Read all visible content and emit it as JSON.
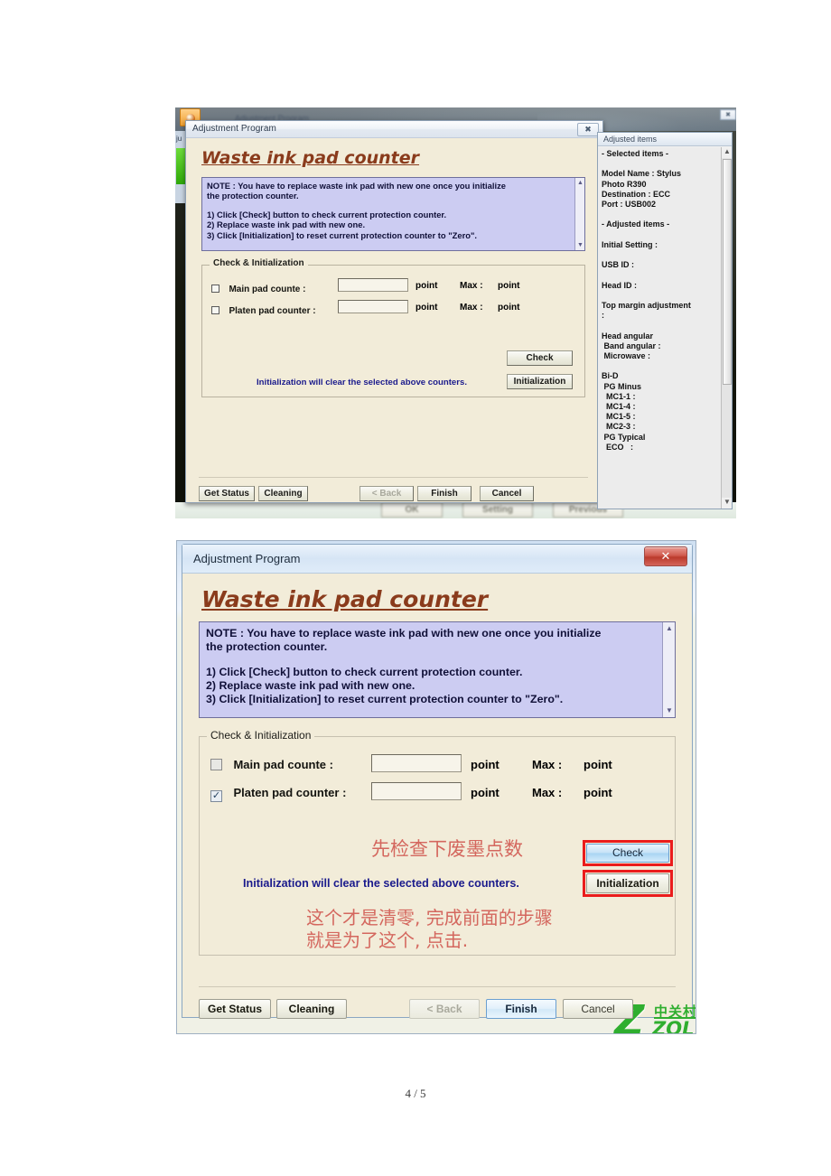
{
  "document": {
    "page_label": "4 / 5"
  },
  "screenshot_top": {
    "background_window": {
      "ghost_title": "Adjustment Program",
      "left_stub_label": "ju",
      "ghost_buttons": [
        "OK",
        "Setting",
        "Previous"
      ]
    },
    "dialog": {
      "title": "Adjustment Program",
      "close_label": "✖",
      "heading": "Waste ink pad counter",
      "note": {
        "line1": "NOTE : You have to replace waste ink pad with new one once you initialize",
        "line2": "the protection counter.",
        "line3": "",
        "line4": "1) Click [Check] button to check current protection counter.",
        "line5": "2) Replace waste ink pad with new one.",
        "line6": "3) Click [Initialization] to reset current protection counter to \"Zero\".",
        "scroll_up": "▲",
        "scroll_down": "▼"
      },
      "group": {
        "legend": "Check & Initialization",
        "rows": [
          {
            "label": "Main pad counte :",
            "value": "",
            "unit": "point",
            "max_label": "Max :",
            "max_unit": "point",
            "checked": false
          },
          {
            "label": "Platen pad counter :",
            "value": "",
            "unit": "point",
            "max_label": "Max :",
            "max_unit": "point",
            "checked": false
          }
        ],
        "check_button": "Check",
        "init_button": "Initialization",
        "init_warning": "Initialization will clear the selected above counters."
      },
      "footer": {
        "get_status": "Get Status",
        "cleaning": "Cleaning",
        "back": "< Back",
        "finish": "Finish",
        "cancel": "Cancel"
      }
    },
    "adjusted_panel": {
      "title": "Adjusted items",
      "scroll_up": "▲",
      "scroll_down": "▼",
      "content": "- Selected items -\n\nModel Name : Stylus\nPhoto R390\nDestination : ECC\nPort : USB002\n\n- Adjusted items -\n\nInitial Setting :\n\nUSB ID :\n\nHead ID :\n\nTop margin adjustment\n:\n\nHead angular\n Band angular :\n Microwave :\n\nBi-D\n PG Minus\n  MC1-1 :\n  MC1-4 :\n  MC1-5 :\n  MC2-3 :\n PG Typical\n  ECO   :"
    }
  },
  "screenshot_bottom": {
    "dialog": {
      "title": "Adjustment Program",
      "close_label": "✕",
      "heading": "Waste ink pad counter",
      "note": {
        "line1": "NOTE : You have to replace waste ink pad with new one once you initialize",
        "line2": "the protection counter.",
        "line3": "",
        "line4": "1) Click [Check] button to check current protection counter.",
        "line5": "2) Replace waste ink pad with new one.",
        "line6": "3) Click [Initialization] to reset current protection counter to \"Zero\".",
        "scroll_up": "▲",
        "scroll_down": "▼"
      },
      "group": {
        "legend": "Check & Initialization",
        "rows": [
          {
            "label": "Main pad counte :",
            "value": "",
            "unit": "point",
            "max_label": "Max :",
            "max_unit": "point",
            "checked": false,
            "check_glyph": ""
          },
          {
            "label": "Platen pad counter :",
            "value": "",
            "unit": "point",
            "max_label": "Max :",
            "max_unit": "point",
            "checked": true,
            "check_glyph": "✓"
          }
        ],
        "check_button": "Check",
        "init_button": "Initialization",
        "init_warning": "Initialization will clear the selected above counters."
      },
      "annotations": {
        "top": "先检查下废墨点数",
        "bottom_line1": "这个才是清零, 完成前面的步骤",
        "bottom_line2": "就是为了这个, 点击."
      },
      "footer": {
        "get_status": "Get Status",
        "cleaning": "Cleaning",
        "back": "< Back",
        "finish": "Finish",
        "cancel": "Cancel"
      }
    },
    "watermark": {
      "logo_letter": "Z",
      "cn": "中关村在线",
      "en": "ZOL.com.cn"
    }
  },
  "colors": {
    "dialog_bg": "#f2ecd9",
    "note_bg": "#ccccf2",
    "heading": "#8a3b1c",
    "warning_text": "#1a1a8c",
    "annotation": "#d4675e",
    "highlight_border": "#ea1c1c",
    "watermark_green": "#2fae2f",
    "close_red": "#bb3a2c"
  }
}
